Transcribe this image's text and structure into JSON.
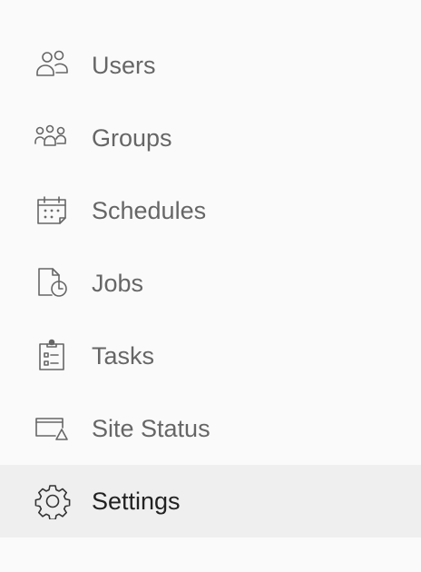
{
  "sidebar": {
    "items": [
      {
        "label": "Users",
        "icon": "users-icon"
      },
      {
        "label": "Groups",
        "icon": "groups-icon"
      },
      {
        "label": "Schedules",
        "icon": "calendar-icon"
      },
      {
        "label": "Jobs",
        "icon": "document-clock-icon"
      },
      {
        "label": "Tasks",
        "icon": "clipboard-icon"
      },
      {
        "label": "Site Status",
        "icon": "window-alert-icon"
      },
      {
        "label": "Settings",
        "icon": "gear-icon",
        "selected": true
      }
    ]
  },
  "colors": {
    "background": "#fafafa",
    "selected_background": "#efefef",
    "text": "#666666",
    "selected_text": "#222222"
  }
}
